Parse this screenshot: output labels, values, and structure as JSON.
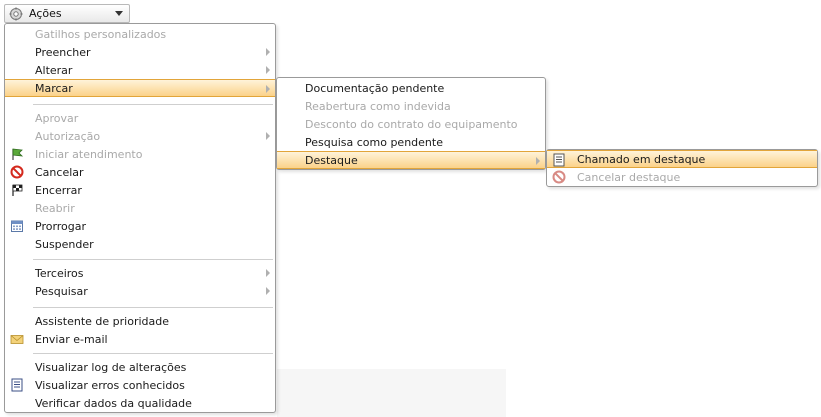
{
  "actions_button": {
    "label": "Ações"
  },
  "main_menu": {
    "items": [
      {
        "label": "Gatilhos personalizados",
        "disabled": true
      },
      {
        "label": "Preencher"
      },
      {
        "label": "Alterar"
      },
      {
        "label": "Marcar"
      },
      {
        "label": "Aprovar",
        "disabled": true
      },
      {
        "label": "Autorização",
        "disabled": true
      },
      {
        "label": "Iniciar atendimento",
        "disabled": true,
        "icon": "green-flag-icon"
      },
      {
        "label": "Cancelar",
        "icon": "cancel-icon"
      },
      {
        "label": "Encerrar",
        "icon": "checkered-flag-icon"
      },
      {
        "label": "Reabrir",
        "disabled": true
      },
      {
        "label": "Prorrogar",
        "icon": "calendar-icon"
      },
      {
        "label": "Suspender"
      },
      {
        "label": "Terceiros"
      },
      {
        "label": "Pesquisar"
      },
      {
        "label": "Assistente de prioridade"
      },
      {
        "label": "Enviar e-mail",
        "icon": "envelope-icon"
      },
      {
        "label": "Visualizar log de alterações"
      },
      {
        "label": "Visualizar erros conhecidos",
        "icon": "document-list-icon"
      },
      {
        "label": "Verificar dados da qualidade"
      }
    ]
  },
  "mark_submenu": {
    "items": [
      {
        "label": "Documentação pendente"
      },
      {
        "label": "Reabertura como indevida",
        "disabled": true
      },
      {
        "label": "Desconto do contrato do equipamento",
        "disabled": true
      },
      {
        "label": "Pesquisa como pendente"
      },
      {
        "label": "Destaque"
      }
    ]
  },
  "highlight_submenu": {
    "items": [
      {
        "label": "Chamado em destaque",
        "icon": "document-list-icon"
      },
      {
        "label": "Cancelar destaque",
        "disabled": true,
        "icon": "cancel-icon"
      }
    ]
  },
  "colors": {
    "highlight_border": "#e2a53a",
    "highlight_fill": "#fbd28a",
    "disabled_text": "#a9a9a9"
  }
}
